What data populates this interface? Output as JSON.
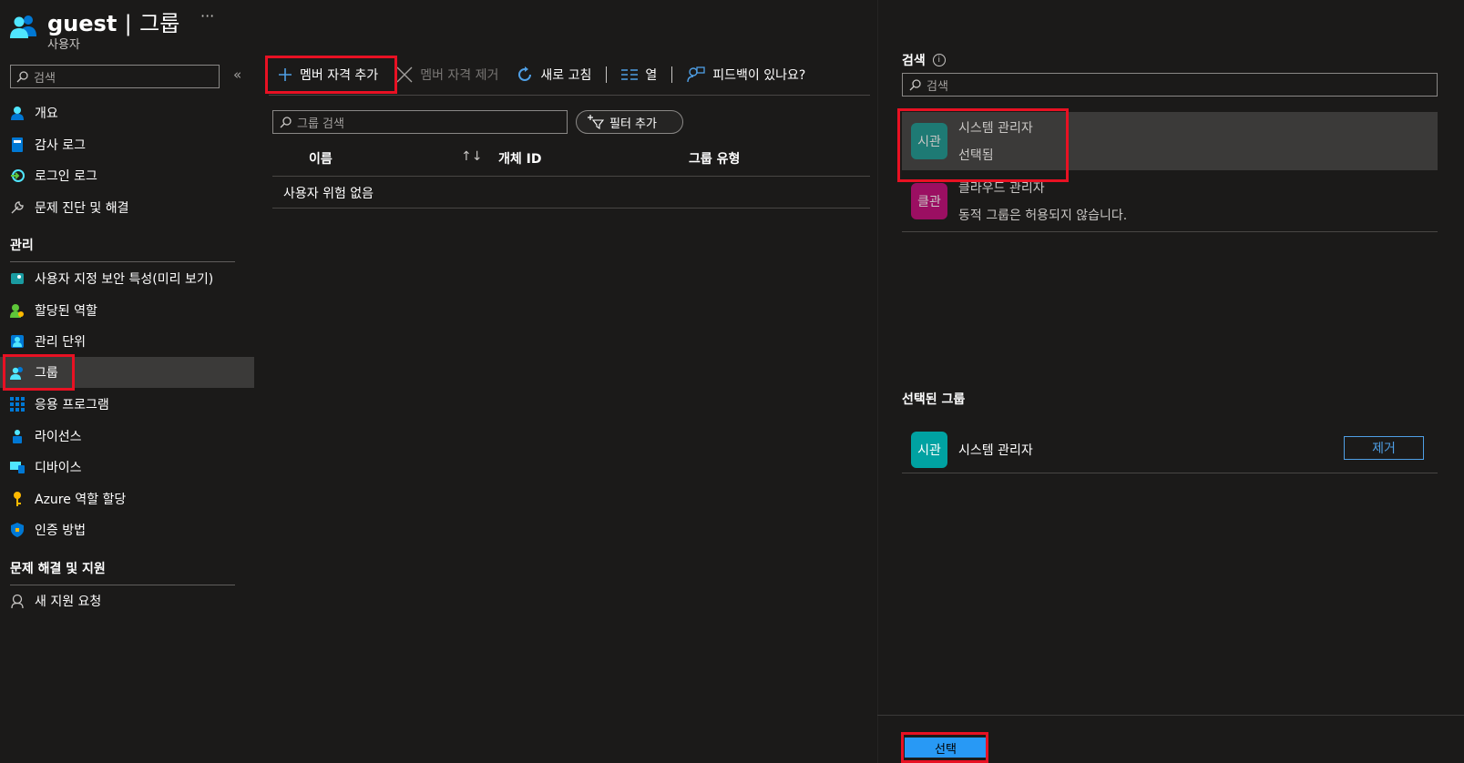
{
  "header": {
    "title_prefix": "guest",
    "title_separator": "|",
    "title_page": "그룹",
    "more": "···",
    "subtitle": "사용자"
  },
  "sidebar": {
    "search_placeholder": "검색",
    "collapse": "«",
    "items": [
      {
        "label": "개요",
        "icon": "user-icon"
      },
      {
        "label": "감사 로그",
        "icon": "book-icon"
      },
      {
        "label": "로그인 로그",
        "icon": "signin-icon"
      },
      {
        "label": "문제 진단 및 해결",
        "icon": "wrench-icon"
      }
    ],
    "section_manage": "관리",
    "manage_items": [
      {
        "label": "사용자 지정 보안 특성(미리 보기)",
        "icon": "security-attr-icon"
      },
      {
        "label": "할당된 역할",
        "icon": "role-icon"
      },
      {
        "label": "관리 단위",
        "icon": "admin-unit-icon"
      },
      {
        "label": "그룹",
        "icon": "groups-icon"
      },
      {
        "label": "응용 프로그램",
        "icon": "apps-grid-icon"
      },
      {
        "label": "라이선스",
        "icon": "license-icon"
      },
      {
        "label": "디바이스",
        "icon": "devices-icon"
      },
      {
        "label": "Azure 역할 할당",
        "icon": "key-icon"
      },
      {
        "label": "인증 방법",
        "icon": "shield-icon"
      }
    ],
    "section_support": "문제 해결 및 지원",
    "support_items": [
      {
        "label": "새 지원 요청",
        "icon": "support-icon"
      }
    ]
  },
  "toolbar": {
    "add_membership": "멤버 자격 추가",
    "remove_membership": "멤버 자격 제거",
    "refresh": "새로 고침",
    "columns": "열",
    "feedback": "피드백이 있나요?"
  },
  "groups": {
    "search_placeholder": "그룹 검색",
    "filter_label": "필터 추가",
    "columns": [
      "이름",
      "개체 ID",
      "그룹 유형"
    ],
    "sort_icon": "↑↓",
    "empty_message": "사용자 위험 없음"
  },
  "panel": {
    "search_label": "검색",
    "search_placeholder": "검색",
    "results": [
      {
        "avatar": "시관",
        "name": "시스템 관리자",
        "sub": "선택됨",
        "color": "#1e7a74"
      },
      {
        "avatar": "클관",
        "name": "클라우드 관리자",
        "sub": "동적 그룹은 허용되지 않습니다.",
        "color": "#9b0f62"
      }
    ],
    "selected_label": "선택된 그룹",
    "selected": [
      {
        "avatar": "시관",
        "name": "시스템 관리자",
        "color": "#00a2a2"
      }
    ],
    "remove_label": "제거",
    "select_label": "선택"
  },
  "colors": {
    "background": "#1b1a19",
    "accent": "#2899f5",
    "highlight": "#e81123"
  }
}
